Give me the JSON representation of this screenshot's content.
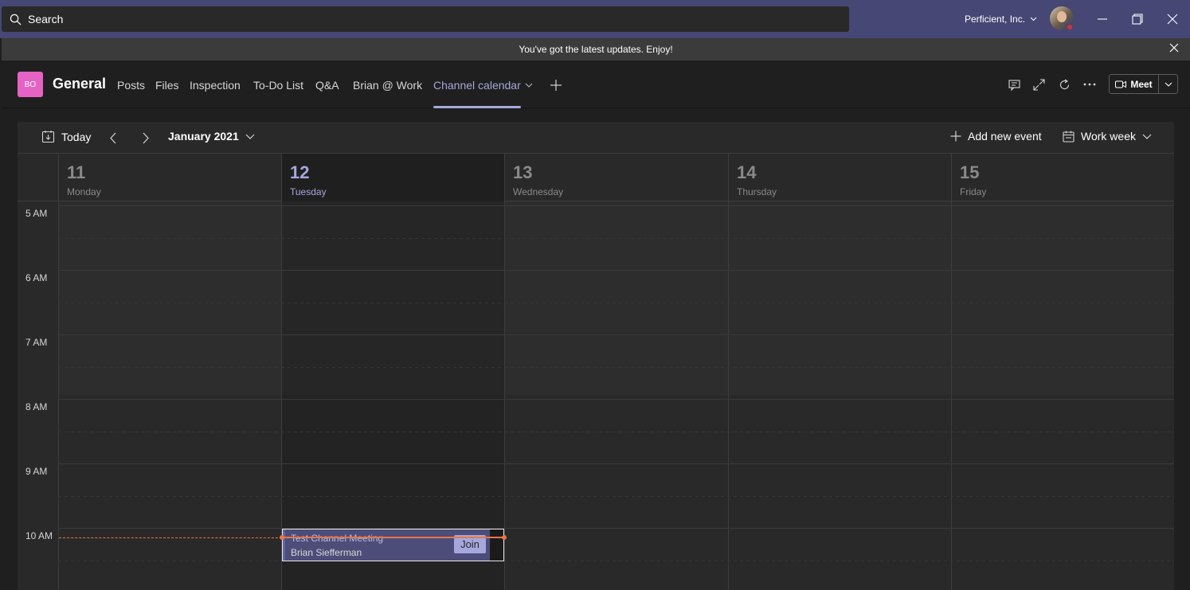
{
  "titlebar": {
    "search_placeholder": "Search",
    "org_name": "Perficient, Inc.",
    "presence_color": "#d13438",
    "accent": "#464775"
  },
  "banner": {
    "text": "You've got the latest updates. Enjoy!"
  },
  "channel": {
    "team_initials": "BO",
    "team_color": "#e563c4",
    "name": "General",
    "tabs": [
      {
        "label": "Posts"
      },
      {
        "label": "Files"
      },
      {
        "label": "Inspection"
      },
      {
        "label": "To-Do List"
      },
      {
        "label": "Q&A"
      },
      {
        "label": "Brian @ Work"
      },
      {
        "label": "Channel calendar",
        "active": true
      }
    ],
    "meet_label": "Meet"
  },
  "calendar": {
    "today_label": "Today",
    "month_label": "January 2021",
    "add_event_label": "Add new event",
    "view_label": "Work week",
    "days": [
      {
        "num": "11",
        "name": "Monday"
      },
      {
        "num": "12",
        "name": "Tuesday",
        "today": true
      },
      {
        "num": "13",
        "name": "Wednesday"
      },
      {
        "num": "14",
        "name": "Thursday"
      },
      {
        "num": "15",
        "name": "Friday"
      }
    ],
    "hours": [
      "5 AM",
      "6 AM",
      "7 AM",
      "8 AM",
      "9 AM",
      "10 AM"
    ],
    "event": {
      "title": "Test Channel Meeting",
      "organizer": "Brian Siefferman",
      "join_label": "Join",
      "day": "Tuesday"
    },
    "now_line_color": "#e97548"
  }
}
